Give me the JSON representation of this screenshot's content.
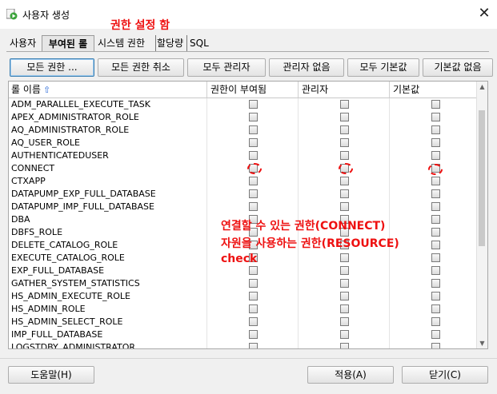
{
  "window": {
    "title": "사용자 생성",
    "close": "✕"
  },
  "annotation": {
    "top": "권한 설정 함",
    "note_line1": "연결할 수 있는 권한(CONNECT)",
    "note_line2": "자원을 사용하는 권한(RESOURCE)",
    "note_line3": "check"
  },
  "tabs": [
    "사용자",
    "부여된 롤",
    "시스템 권한",
    "할당량",
    "SQL"
  ],
  "toolbar": [
    "모든 권한 ...",
    "모든 권한 취소",
    "모두 관리자",
    "관리자 없음",
    "모두 기본값",
    "기본값 없음"
  ],
  "table": {
    "headers": [
      "롤 이름",
      "권한이 부여됨",
      "관리자",
      "기본값"
    ],
    "sort_icon": "⇧",
    "rows": [
      "ADM_PARALLEL_EXECUTE_TASK",
      "APEX_ADMINISTRATOR_ROLE",
      "AQ_ADMINISTRATOR_ROLE",
      "AQ_USER_ROLE",
      "AUTHENTICATEDUSER",
      "CONNECT",
      "CTXAPP",
      "DATAPUMP_EXP_FULL_DATABASE",
      "DATAPUMP_IMP_FULL_DATABASE",
      "DBA",
      "DBFS_ROLE",
      "DELETE_CATALOG_ROLE",
      "EXECUTE_CATALOG_ROLE",
      "EXP_FULL_DATABASE",
      "GATHER_SYSTEM_STATISTICS",
      "HS_ADMIN_EXECUTE_ROLE",
      "HS_ADMIN_ROLE",
      "HS_ADMIN_SELECT_ROLE",
      "IMP_FULL_DATABASE",
      "LOGSTDBY_ADMINISTRATOR"
    ]
  },
  "footer": {
    "help": "도움말(H)",
    "apply": "적용(A)",
    "close": "닫기(C)"
  },
  "colors": {
    "annotation": "#ee1111",
    "focus": "#3c7fb1"
  }
}
